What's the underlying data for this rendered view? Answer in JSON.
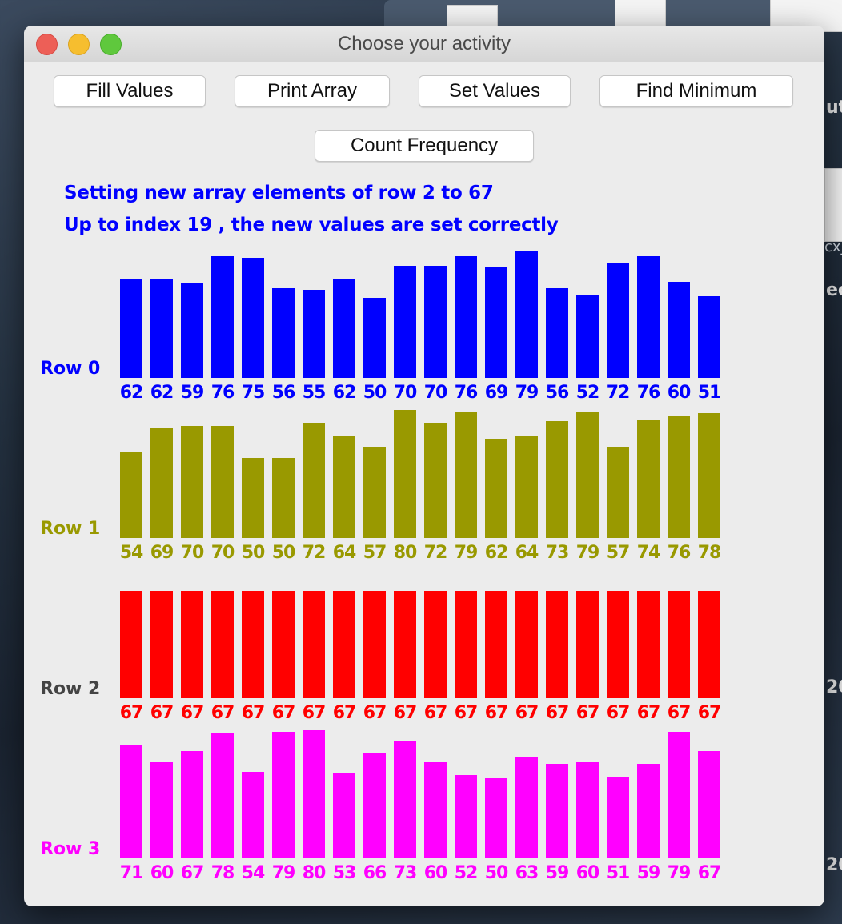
{
  "window": {
    "title": "Choose your activity"
  },
  "buttons": {
    "fill_values": "Fill Values",
    "print_array": "Print Array",
    "set_values": "Set Values",
    "find_minimum": "Find Minimum",
    "count_frequency": "Count Frequency"
  },
  "messages": {
    "line1": "Setting new array elements of row 2 to 67",
    "line2": "Up to index 19 , the new values are set correctly"
  },
  "desktop": {
    "partial_text_1": "ut",
    "partial_text_2": "cx_",
    "partial_text_3": "ec",
    "partial_text_4": "20",
    "partial_text_5": "20"
  },
  "rows": [
    {
      "label": "Row 0",
      "color": "#0000ff",
      "label_color": "#0000ff",
      "values": [
        62,
        62,
        59,
        76,
        75,
        56,
        55,
        62,
        50,
        70,
        70,
        76,
        69,
        79,
        56,
        52,
        72,
        76,
        60,
        51
      ]
    },
    {
      "label": "Row 1",
      "color": "#999900",
      "label_color": "#999900",
      "values": [
        54,
        69,
        70,
        70,
        50,
        50,
        72,
        64,
        57,
        80,
        72,
        79,
        62,
        64,
        73,
        79,
        57,
        74,
        76,
        78
      ]
    },
    {
      "label": "Row 2",
      "color": "#ff0000",
      "label_color": "#444444",
      "values": [
        67,
        67,
        67,
        67,
        67,
        67,
        67,
        67,
        67,
        67,
        67,
        67,
        67,
        67,
        67,
        67,
        67,
        67,
        67,
        67
      ]
    },
    {
      "label": "Row 3",
      "color": "#ff00ff",
      "label_color": "#ff00ff",
      "values": [
        71,
        60,
        67,
        78,
        54,
        79,
        80,
        53,
        66,
        73,
        60,
        52,
        50,
        63,
        59,
        60,
        51,
        59,
        79,
        67
      ]
    }
  ]
}
